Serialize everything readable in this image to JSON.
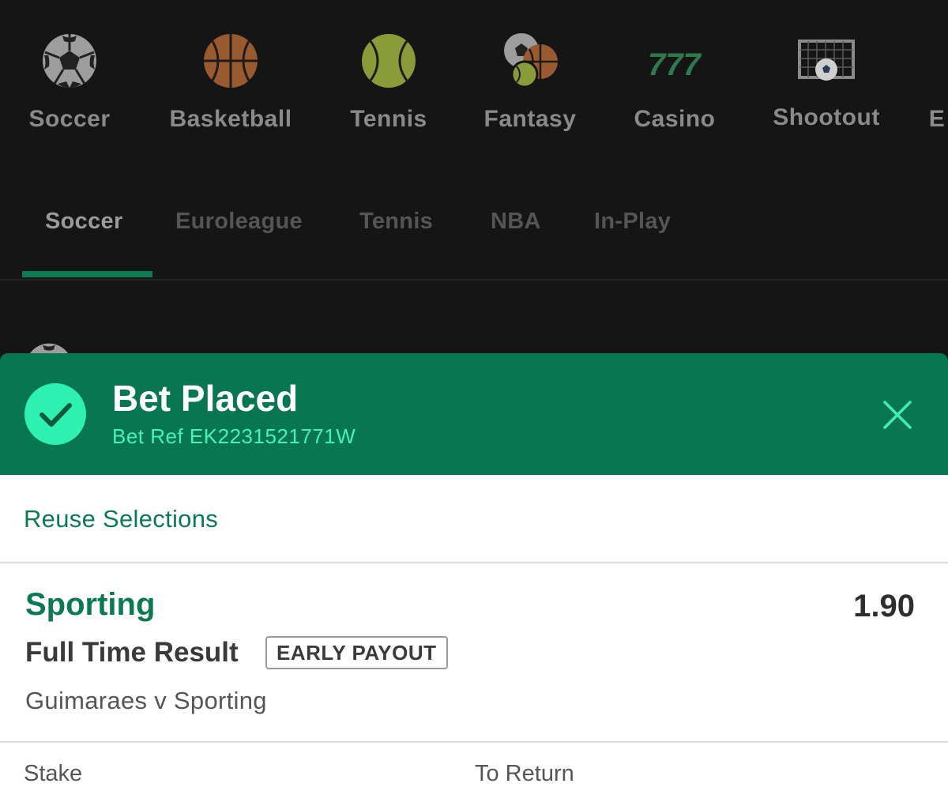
{
  "sport_nav": {
    "items": [
      {
        "label": "Soccer",
        "icon": "soccer-ball-icon"
      },
      {
        "label": "Basketball",
        "icon": "basketball-icon"
      },
      {
        "label": "Tennis",
        "icon": "tennis-ball-icon"
      },
      {
        "label": "Fantasy",
        "icon": "fantasy-balls-icon"
      },
      {
        "label": "Casino",
        "icon": "slot-777-icon"
      },
      {
        "label": "Shootout",
        "icon": "goal-net-icon"
      },
      {
        "label": "E",
        "icon": "cut-off-item"
      }
    ]
  },
  "sub_tabs": {
    "items": [
      {
        "label": "Soccer",
        "active": true
      },
      {
        "label": "Euroleague",
        "active": false
      },
      {
        "label": "Tennis",
        "active": false
      },
      {
        "label": "NBA",
        "active": false
      },
      {
        "label": "In-Play",
        "active": false
      }
    ]
  },
  "bet_confirmation": {
    "title": "Bet Placed",
    "ref": "Bet Ref EK2231521771W",
    "icon": "check-circle-icon",
    "close_icon": "close-icon"
  },
  "reuse": {
    "label": "Reuse Selections"
  },
  "selection": {
    "name": "Sporting",
    "odds": "1.90",
    "market": "Full Time Result",
    "badge": "EARLY PAYOUT",
    "event": "Guimaraes v Sporting"
  },
  "footer": {
    "stake_label": "Stake",
    "return_label": "To Return"
  },
  "colors": {
    "brand_green": "#097652",
    "accent_mint": "#2ef0b0",
    "link_green": "#0b7a50",
    "dark_bg": "#151515"
  }
}
